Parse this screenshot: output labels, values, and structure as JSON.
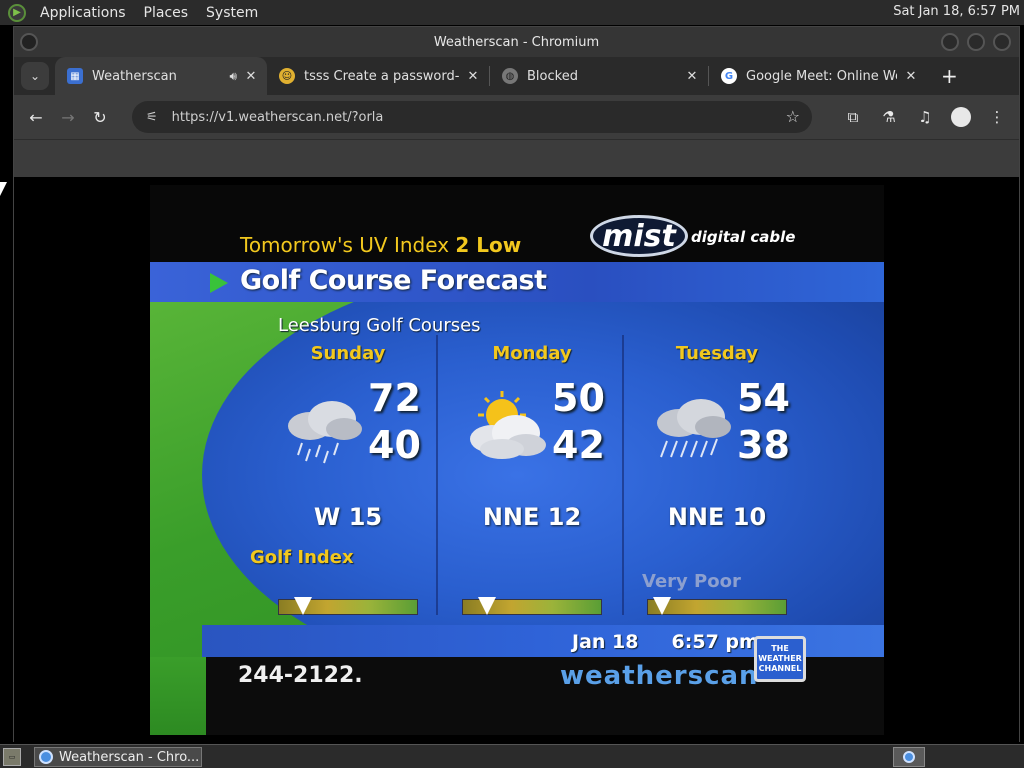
{
  "top_panel": {
    "menus": [
      "Applications",
      "Places",
      "System"
    ],
    "clock": "Sat Jan 18,  6:57 PM"
  },
  "window": {
    "title": "Weatherscan - Chromium"
  },
  "tabs": [
    {
      "title": "Weatherscan",
      "icon": "weatherscan-favicon",
      "audio": true,
      "active": true
    },
    {
      "title": "tsss Create a password-p",
      "icon": "emoji-favicon",
      "active": false
    },
    {
      "title": "Blocked",
      "icon": "globe-favicon",
      "active": false
    },
    {
      "title": "Google Meet: Online Web",
      "icon": "google-favicon",
      "active": false
    }
  ],
  "toolbar": {
    "url": "https://v1.weatherscan.net/?orla"
  },
  "weatherscan": {
    "uv_prefix": "Tomorrow's UV Index ",
    "uv_value": "2 Low",
    "mist_logo": "mist",
    "mist_sub": "digital cable",
    "section_title": "Golf Course Forecast",
    "location": "Leesburg Golf Courses",
    "days": [
      {
        "name": "Sunday",
        "high": "72",
        "low": "40",
        "wind": "W 15",
        "condition_icon": "cloud-rain-icon",
        "golf_index_level": 0.17
      },
      {
        "name": "Monday",
        "high": "50",
        "low": "42",
        "wind": "NNE 12",
        "condition_icon": "sun-cloud-icon",
        "golf_index_level": 0.17
      },
      {
        "name": "Tuesday",
        "high": "54",
        "low": "38",
        "wind": "NNE 10",
        "condition_icon": "cloud-heavy-rain-icon",
        "golf_index_level": 0.1
      }
    ],
    "golf_index_label": "Golf Index",
    "golf_index_rating": "Very Poor",
    "date_time": "Jan 18     6:57 pm",
    "phone": "244-2122.",
    "brand": "weatherscan",
    "twc_logo": "THE WEATHER CHANNEL"
  },
  "taskbar": {
    "task_title": "Weatherscan - Chro..."
  },
  "colors": {
    "accent_yellow": "#f2c81e",
    "panel_bg": "#2b2b2b",
    "ws_blue": "#2a5fcf",
    "ws_green": "#3a9e2a"
  }
}
